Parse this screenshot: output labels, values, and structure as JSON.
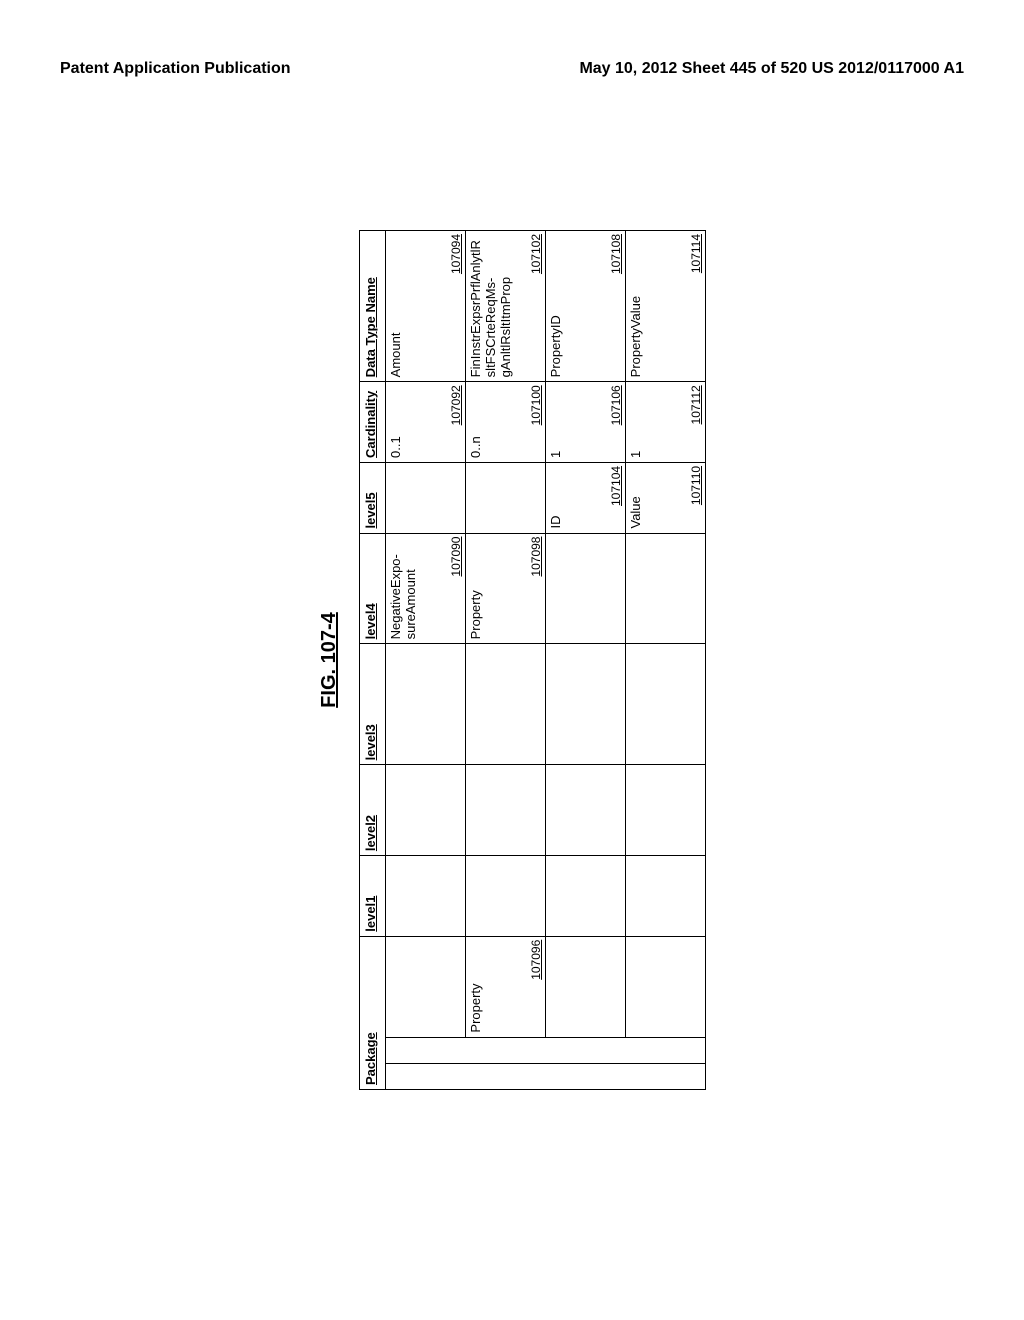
{
  "header": {
    "left": "Patent Application Publication",
    "right": "May 10, 2012  Sheet 445 of 520   US 2012/0117000 A1"
  },
  "figure": {
    "title": "FIG. 107-4",
    "columns": {
      "package": "Package",
      "level1": "level1",
      "level2": "level2",
      "level3": "level3",
      "level4": "level4",
      "level5": "level5",
      "cardinality": "Cardinality",
      "datatype": "Data Type Name"
    },
    "rows": [
      {
        "package": "",
        "package_ref": "",
        "level1": "",
        "level2": "",
        "level3": "",
        "level4": "NegativeExpo-sureAmount",
        "level4_ref": "107090",
        "level5": "",
        "level5_ref": "",
        "cardinality": "0..1",
        "cardinality_ref": "107092",
        "datatype": "Amount",
        "datatype_ref": "107094"
      },
      {
        "package": "Property",
        "package_ref": "107096",
        "level1": "",
        "level2": "",
        "level3": "",
        "level4": "Property",
        "level4_ref": "107098",
        "level5": "",
        "level5_ref": "",
        "cardinality": "0..n",
        "cardinality_ref": "107100",
        "datatype": "FinInstrExpsrPrflAnlytlRsltFSCrteReqMs-gAnltlRsltItmProp",
        "datatype_ref": "107102"
      },
      {
        "package": "",
        "package_ref": "",
        "level1": "",
        "level2": "",
        "level3": "",
        "level4": "",
        "level4_ref": "",
        "level5": "ID",
        "level5_ref": "107104",
        "cardinality": "1",
        "cardinality_ref": "107106",
        "datatype": "PropertyID",
        "datatype_ref": "107108"
      },
      {
        "package": "",
        "package_ref": "",
        "level1": "",
        "level2": "",
        "level3": "",
        "level4": "",
        "level4_ref": "",
        "level5": "Value",
        "level5_ref": "107110",
        "cardinality": "1",
        "cardinality_ref": "107112",
        "datatype": "PropertyValue",
        "datatype_ref": "107114"
      }
    ]
  }
}
